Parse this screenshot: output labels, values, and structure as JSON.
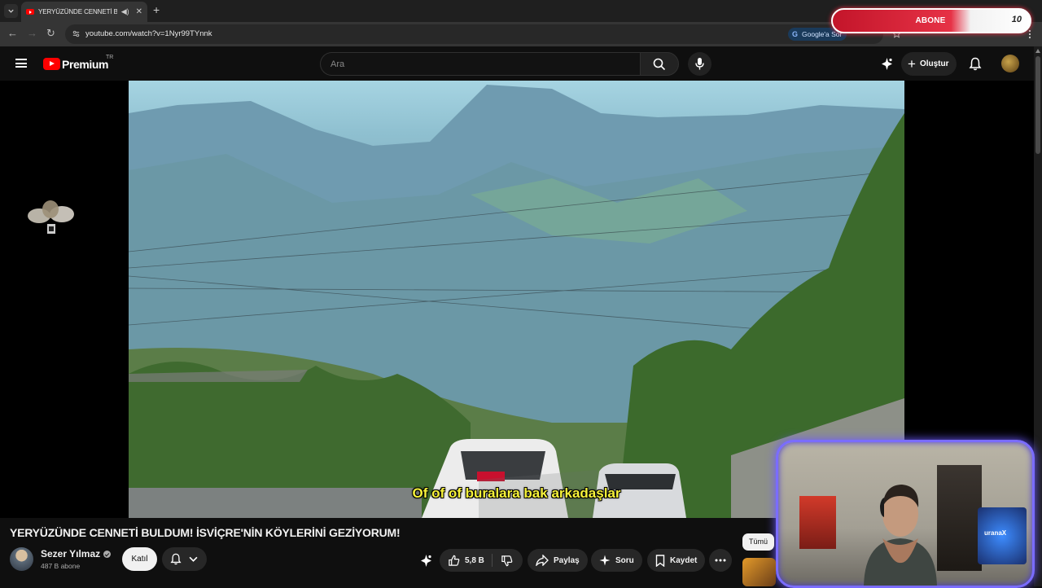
{
  "browser": {
    "tab_title": "YERYÜZÜNDE CENNETİ BULDUM! İSVİÇRE'NİN KÖYLERİNİ GEZİYORUM!",
    "url": "youtube.com/watch?v=1Nyr99TYnnk",
    "google_chip": "Google'a Sor"
  },
  "stream_overlay": {
    "abone_label": "ABONE",
    "abone_count": "10"
  },
  "header": {
    "brand": "Premium",
    "country": "TR",
    "search_placeholder": "Ara",
    "create_label": "Oluştur"
  },
  "player": {
    "subtitle": "Of of of buralara bak arkadaşlar",
    "webcam_screen_logo": "uranaX"
  },
  "video": {
    "title": "YERYÜZÜNDE CENNETİ BULDUM! İSVİÇRE'NİN KÖYLERİNİ GEZİYORUM!",
    "channel_name": "Sezer Yılmaz",
    "subscribers": "487 B abone",
    "join_label": "Katıl",
    "like_count": "5,8 B",
    "share_label": "Paylaş",
    "ask_label": "Soru",
    "save_label": "Kaydet"
  },
  "sidebar": {
    "chip_all": "Tümü"
  },
  "colors": {
    "background": "#0f0f0f",
    "brand_red": "#ff0000",
    "subtitle_yellow": "#f7f33a",
    "webcam_border": "#7a6cff",
    "abone_red": "#e63246"
  }
}
